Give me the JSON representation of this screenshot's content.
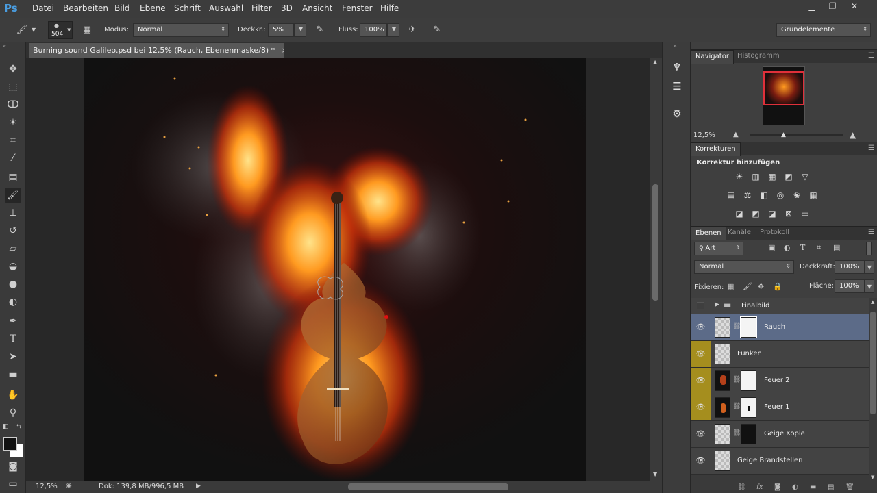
{
  "app": {
    "logo": "Ps"
  },
  "menu": [
    "Datei",
    "Bearbeiten",
    "Bild",
    "Ebene",
    "Schrift",
    "Auswahl",
    "Filter",
    "3D",
    "Ansicht",
    "Fenster",
    "Hilfe"
  ],
  "options": {
    "brush_size": "504",
    "modus_label": "Modus:",
    "modus_value": "Normal",
    "deckkraft_label": "Deckkr.:",
    "deckkraft_value": "5%",
    "fluss_label": "Fluss:",
    "fluss_value": "100%",
    "workspace": "Grundelemente"
  },
  "document": {
    "tab_title": "Burning sound  Galileo.psd bei 12,5% (Rauch, Ebenenmaske/8) *",
    "close": "×"
  },
  "status": {
    "zoom": "12,5%",
    "doc_info": "Dok: 139,8 MB/996,5 MB"
  },
  "navigator": {
    "tab_active": "Navigator",
    "tab_other": "Histogramm",
    "zoom": "12,5%"
  },
  "korrekturen": {
    "tab": "Korrekturen",
    "heading": "Korrektur hinzufügen"
  },
  "ebenen": {
    "tabs": [
      "Ebenen",
      "Kanäle",
      "Protokoll"
    ],
    "filter_kind": "Art",
    "blend_mode": "Normal",
    "opacity_label": "Deckkraft:",
    "opacity_value": "100%",
    "lock_label": "Fixieren:",
    "fill_label": "Fläche:",
    "fill_value": "100%",
    "layers": [
      {
        "name": "Finalbild",
        "type": "group",
        "visible": false
      },
      {
        "name": "Rauch",
        "selected": true
      },
      {
        "name": "Funken"
      },
      {
        "name": "Feuer 2"
      },
      {
        "name": "Feuer 1"
      },
      {
        "name": "Geige Kopie"
      },
      {
        "name": "Geige Brandstellen"
      }
    ]
  },
  "colors": {
    "selected_layer": "#5c6b88",
    "highlight_eye": "#a58e1e",
    "ps_blue": "#4a9de0"
  }
}
